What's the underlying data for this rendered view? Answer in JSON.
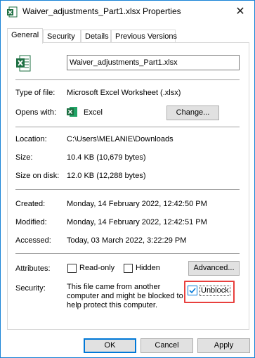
{
  "window": {
    "title": "Waiver_adjustments_Part1.xlsx Properties",
    "close_glyph": "✕",
    "accent": "#1883d7"
  },
  "tabs": [
    {
      "label": "General",
      "active": true
    },
    {
      "label": "Security",
      "active": false
    },
    {
      "label": "Details",
      "active": false
    },
    {
      "label": "Previous Versions",
      "active": false
    }
  ],
  "general": {
    "file_icon": "excel-file-icon",
    "file_name": "Waiver_adjustments_Part1.xlsx",
    "type_of_file": {
      "label": "Type of file:",
      "value": "Microsoft Excel Worksheet (.xlsx)"
    },
    "opens_with": {
      "label": "Opens with:",
      "app_icon": "excel-app-icon",
      "value": "Excel",
      "change_button": "Change..."
    },
    "location": {
      "label": "Location:",
      "value": "C:\\Users\\MELANIE\\Downloads"
    },
    "size": {
      "label": "Size:",
      "value": "10.4 KB (10,679 bytes)"
    },
    "size_on_disk": {
      "label": "Size on disk:",
      "value": "12.0 KB (12,288 bytes)"
    },
    "created": {
      "label": "Created:",
      "value": "Monday, 14 February 2022, 12:42:50 PM"
    },
    "modified": {
      "label": "Modified:",
      "value": "Monday, 14 February 2022, 12:42:51 PM"
    },
    "accessed": {
      "label": "Accessed:",
      "value": "Today, 03 March 2022, 3:22:29 PM"
    },
    "attributes": {
      "label": "Attributes:",
      "read_only": {
        "label": "Read-only",
        "checked": false
      },
      "hidden": {
        "label": "Hidden",
        "checked": false
      },
      "advanced_button": "Advanced..."
    },
    "security": {
      "label": "Security:",
      "line1": "This file came from another",
      "line2": "computer and might be blocked to",
      "line3": "help protect this computer.",
      "unblock": {
        "label": "Unblock",
        "checked": true
      },
      "highlight_color": "#e8403e"
    }
  },
  "footer": {
    "ok": "OK",
    "cancel": "Cancel",
    "apply": "Apply"
  },
  "colors": {
    "excel_green": "#1d6f42",
    "button_face": "#e1e1e1",
    "default_button_border": "#0078d7"
  }
}
